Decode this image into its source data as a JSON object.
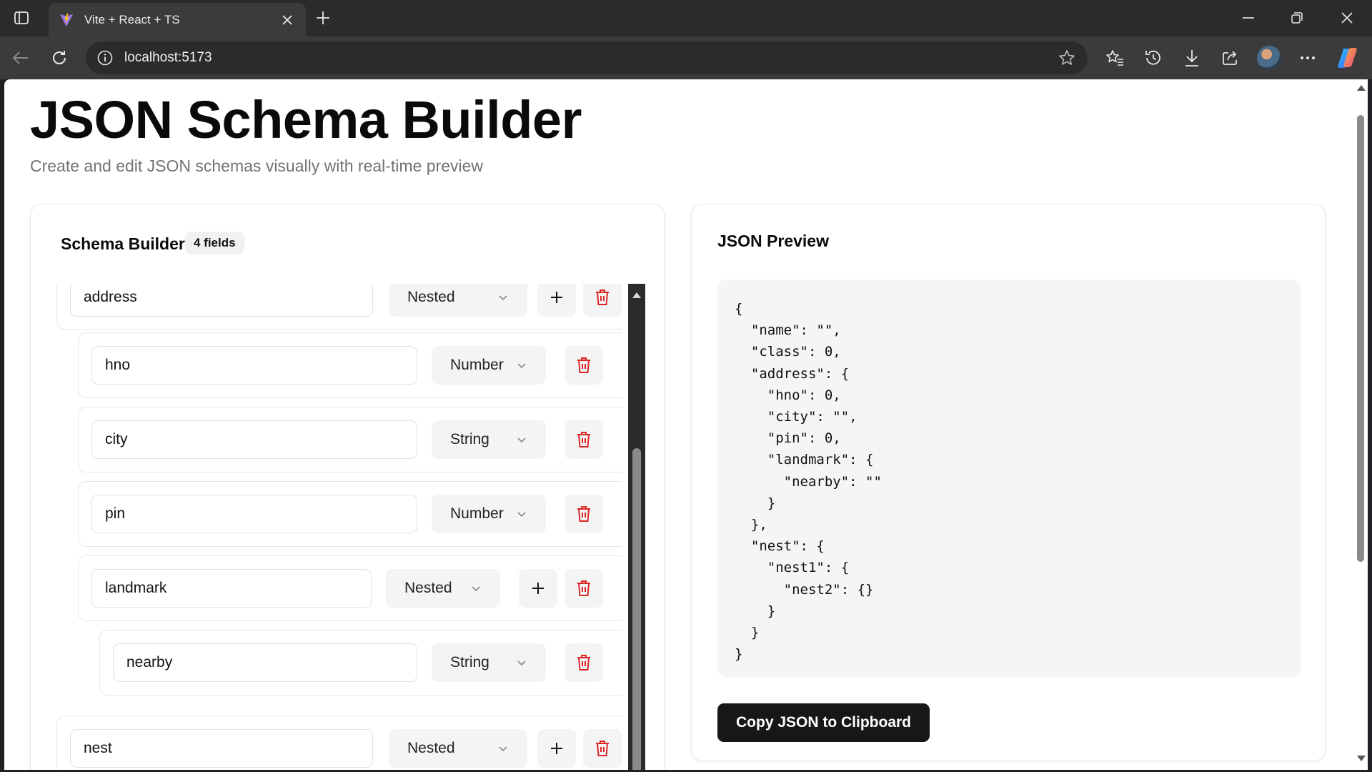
{
  "browser": {
    "tab_title": "Vite + React + TS",
    "url": "localhost:5173"
  },
  "page": {
    "title": "JSON Schema Builder",
    "subtitle": "Create and edit JSON schemas visually with real-time preview"
  },
  "builder": {
    "title": "Schema Builder",
    "field_count": "4 fields",
    "fields": [
      {
        "name": "address",
        "type": "Nested",
        "depth": 0,
        "has_add": true
      },
      {
        "name": "hno",
        "type": "Number",
        "depth": 1,
        "has_add": false
      },
      {
        "name": "city",
        "type": "String",
        "depth": 1,
        "has_add": false
      },
      {
        "name": "pin",
        "type": "Number",
        "depth": 1,
        "has_add": false
      },
      {
        "name": "landmark",
        "type": "Nested",
        "depth": 1,
        "has_add": true
      },
      {
        "name": "nearby",
        "type": "String",
        "depth": 2,
        "has_add": false
      },
      {
        "name": "nest",
        "type": "Nested",
        "depth": 0,
        "has_add": true
      }
    ]
  },
  "preview": {
    "title": "JSON Preview",
    "json_text": "{\n  \"name\": \"\",\n  \"class\": 0,\n  \"address\": {\n    \"hno\": 0,\n    \"city\": \"\",\n    \"pin\": 0,\n    \"landmark\": {\n      \"nearby\": \"\"\n    }\n  },\n  \"nest\": {\n    \"nest1\": {\n      \"nest2\": {}\n    }\n  }\n}",
    "copy_button": "Copy JSON to Clipboard"
  },
  "colors": {
    "delete_icon": "#dc2626",
    "primary_button": "#171717",
    "muted_text": "#737373"
  }
}
